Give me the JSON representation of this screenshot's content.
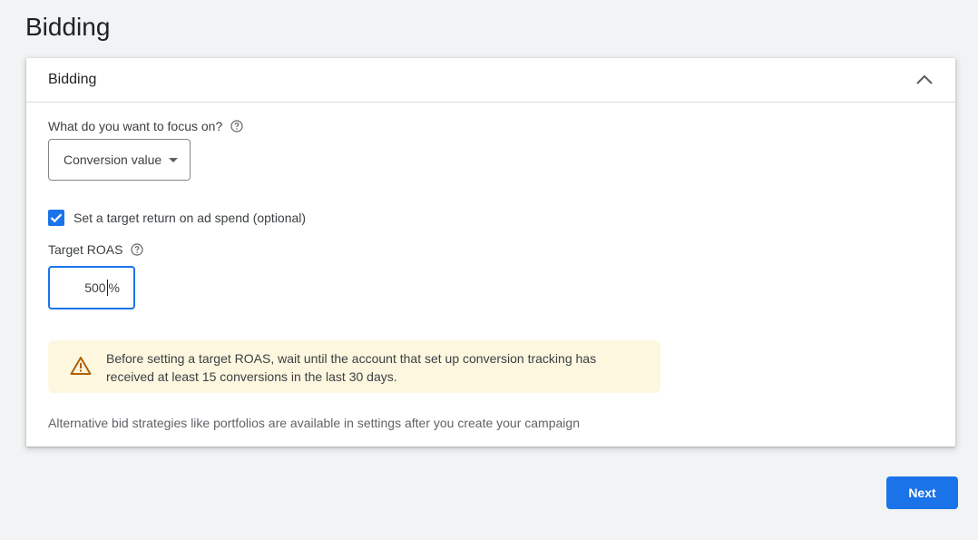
{
  "page": {
    "title": "Bidding"
  },
  "card": {
    "title": "Bidding",
    "collapse_icon": "chevron-up-icon"
  },
  "focus": {
    "label": "What do you want to focus on?",
    "help_icon": "help-circle-icon",
    "selected_value": "Conversion value"
  },
  "target_checkbox": {
    "checked": true,
    "label": "Set a target return on ad spend (optional)"
  },
  "roas": {
    "label": "Target ROAS",
    "help_icon": "help-circle-icon",
    "value": "500",
    "unit": "%"
  },
  "warning": {
    "icon": "warning-triangle-icon",
    "text": "Before setting a target ROAS, wait until the account that set up conversion tracking has received at least 15 conversions in the last 30 days."
  },
  "footnote": "Alternative bid strategies like portfolios are available in settings after you create your campaign",
  "actions": {
    "next_label": "Next"
  },
  "colors": {
    "accent": "#1a73e8",
    "background": "#f1f3f4",
    "warning_bg": "#fef7e0",
    "warning_icon": "#b06000"
  }
}
